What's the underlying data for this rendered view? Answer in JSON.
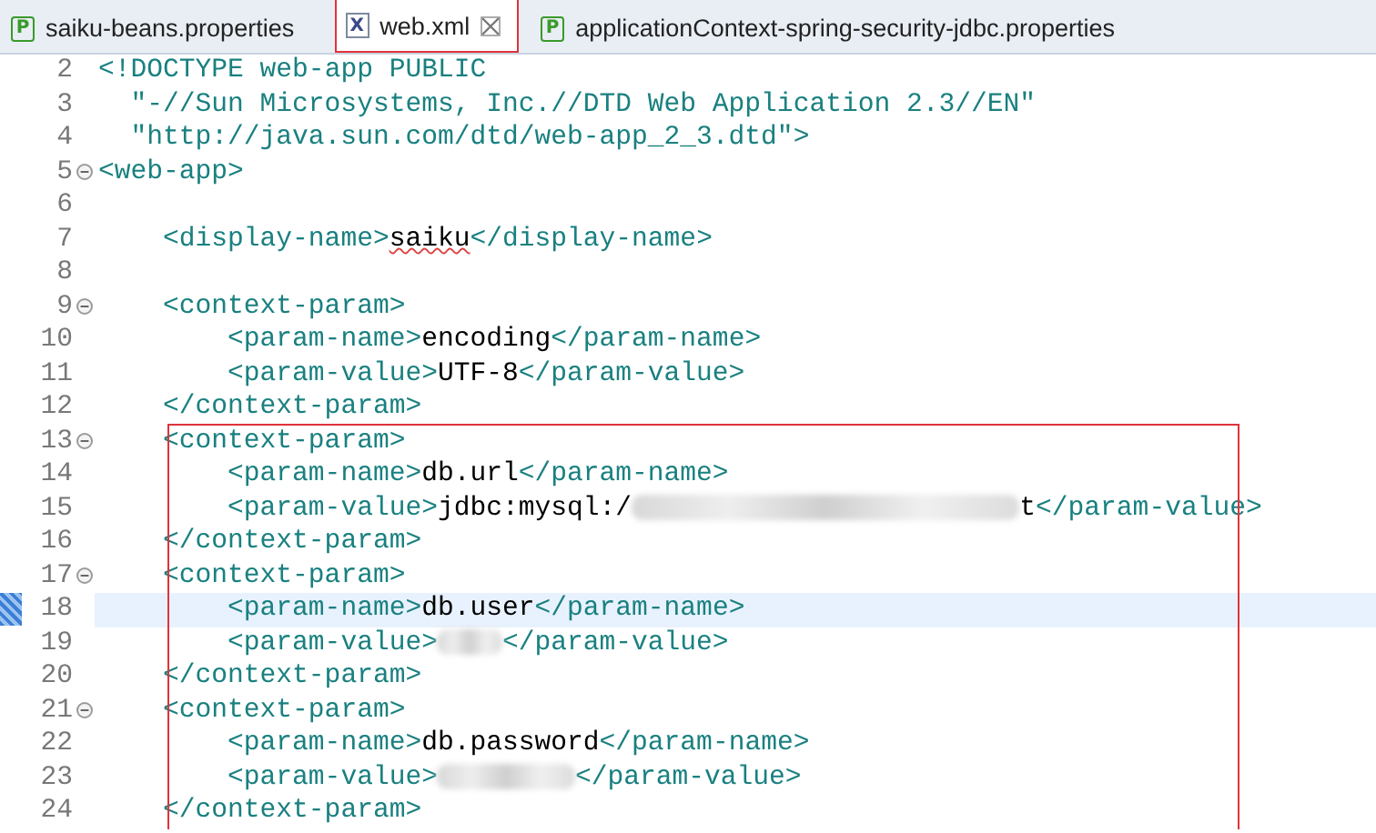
{
  "tabs": [
    {
      "icon": "P",
      "label": "saiku-beans.properties",
      "selected": false,
      "closable": false
    },
    {
      "icon": "X",
      "label": "web.xml",
      "selected": true,
      "closable": true
    },
    {
      "icon": "P",
      "label": "applicationContext-spring-security-jdbc.properties",
      "selected": false,
      "closable": false
    }
  ],
  "editor": {
    "lines": [
      {
        "number": "2",
        "kind": "root",
        "foldable": false,
        "current": false,
        "framed": false,
        "segments": [
          {
            "kind": "tag",
            "text": "<!DOCTYPE web-app PUBLIC"
          }
        ]
      },
      {
        "number": "3",
        "kind": "continuation",
        "foldable": false,
        "current": false,
        "framed": false,
        "segments": [
          {
            "kind": "string",
            "text": "\"-//Sun Microsystems, Inc.//DTD Web Application 2.3//EN\""
          }
        ]
      },
      {
        "number": "4",
        "kind": "continuation",
        "foldable": false,
        "current": false,
        "framed": false,
        "segments": [
          {
            "kind": "string",
            "text": "\"http://java.sun.com/dtd/web-app_2_3.dtd\""
          },
          {
            "kind": "tag",
            "text": ">"
          }
        ]
      },
      {
        "number": "5",
        "kind": "root",
        "foldable": true,
        "current": false,
        "framed": false,
        "segments": [
          {
            "kind": "tag",
            "text": "<web-app>"
          }
        ]
      },
      {
        "number": "6",
        "kind": "blank",
        "foldable": false,
        "current": false,
        "framed": false
      },
      {
        "number": "7",
        "kind": "child",
        "foldable": false,
        "current": false,
        "framed": false,
        "segments": [
          {
            "kind": "tag",
            "text": "<display-name>"
          },
          {
            "kind": "misspelled",
            "text": "saiku"
          },
          {
            "kind": "tag",
            "text": "</display-name>"
          }
        ]
      },
      {
        "number": "8",
        "kind": "blank",
        "foldable": false,
        "current": false,
        "framed": false
      },
      {
        "number": "9",
        "kind": "child",
        "foldable": true,
        "current": false,
        "framed": false,
        "segments": [
          {
            "kind": "tag",
            "text": "<context-param>"
          }
        ]
      },
      {
        "number": "10",
        "kind": "grandchild",
        "foldable": false,
        "current": false,
        "framed": false,
        "segments": [
          {
            "kind": "tag",
            "text": "<param-name>"
          },
          {
            "kind": "text",
            "text": "encoding"
          },
          {
            "kind": "tag",
            "text": "</param-name>"
          }
        ]
      },
      {
        "number": "11",
        "kind": "grandchild",
        "foldable": false,
        "current": false,
        "framed": false,
        "segments": [
          {
            "kind": "tag",
            "text": "<param-value>"
          },
          {
            "kind": "text",
            "text": "UTF-8"
          },
          {
            "kind": "tag",
            "text": "</param-value>"
          }
        ]
      },
      {
        "number": "12",
        "kind": "child",
        "foldable": false,
        "current": false,
        "framed": false,
        "segments": [
          {
            "kind": "tag",
            "text": "</context-param>"
          }
        ]
      },
      {
        "number": "13",
        "kind": "child",
        "foldable": true,
        "current": false,
        "framed": true,
        "segments": [
          {
            "kind": "tag",
            "text": "<context-param>"
          }
        ]
      },
      {
        "number": "14",
        "kind": "grandchild",
        "foldable": false,
        "current": false,
        "framed": true,
        "segments": [
          {
            "kind": "tag",
            "text": "<param-name>"
          },
          {
            "kind": "text",
            "text": "db.url"
          },
          {
            "kind": "tag",
            "text": "</param-name>"
          }
        ]
      },
      {
        "number": "15",
        "kind": "grandchild",
        "foldable": false,
        "current": false,
        "framed": true,
        "segments": [
          {
            "kind": "tag",
            "text": "<param-value>"
          },
          {
            "kind": "text",
            "text": "jdbc:mysql:/"
          },
          {
            "kind": "blurlong"
          },
          {
            "kind": "text",
            "text": "t"
          },
          {
            "kind": "tag",
            "text": "</param-value>"
          }
        ]
      },
      {
        "number": "16",
        "kind": "child",
        "foldable": false,
        "current": false,
        "framed": true,
        "segments": [
          {
            "kind": "tag",
            "text": "</context-param>"
          }
        ]
      },
      {
        "number": "17",
        "kind": "child",
        "foldable": true,
        "current": false,
        "framed": true,
        "segments": [
          {
            "kind": "tag",
            "text": "<context-param>"
          }
        ]
      },
      {
        "number": "18",
        "kind": "grandchild",
        "foldable": false,
        "current": true,
        "framed": true,
        "segments": [
          {
            "kind": "tag",
            "text": "<param-name>"
          },
          {
            "kind": "text",
            "text": "db.user"
          },
          {
            "kind": "tag",
            "text": "</param-name>"
          }
        ]
      },
      {
        "number": "19",
        "kind": "grandchild",
        "foldable": false,
        "current": false,
        "framed": true,
        "segments": [
          {
            "kind": "tag",
            "text": "<param-value>"
          },
          {
            "kind": "blurshort"
          },
          {
            "kind": "tag",
            "text": "</param-value>"
          }
        ]
      },
      {
        "number": "20",
        "kind": "child",
        "foldable": false,
        "current": false,
        "framed": true,
        "segments": [
          {
            "kind": "tag",
            "text": "</context-param>"
          }
        ]
      },
      {
        "number": "21",
        "kind": "child",
        "foldable": true,
        "current": false,
        "framed": true,
        "segments": [
          {
            "kind": "tag",
            "text": "<context-param>"
          }
        ]
      },
      {
        "number": "22",
        "kind": "grandchild",
        "foldable": false,
        "current": false,
        "framed": true,
        "segments": [
          {
            "kind": "tag",
            "text": "<param-name>"
          },
          {
            "kind": "text",
            "text": "db.password"
          },
          {
            "kind": "tag",
            "text": "</param-name>"
          }
        ]
      },
      {
        "number": "23",
        "kind": "grandchild",
        "foldable": false,
        "current": false,
        "framed": true,
        "segments": [
          {
            "kind": "tag",
            "text": "<param-value>"
          },
          {
            "kind": "blurmedium"
          },
          {
            "kind": "tag",
            "text": "</param-value>"
          }
        ]
      },
      {
        "number": "24",
        "kind": "child",
        "foldable": false,
        "current": false,
        "framed": true,
        "segments": [
          {
            "kind": "tag",
            "text": "</context-param>"
          }
        ]
      }
    ]
  }
}
